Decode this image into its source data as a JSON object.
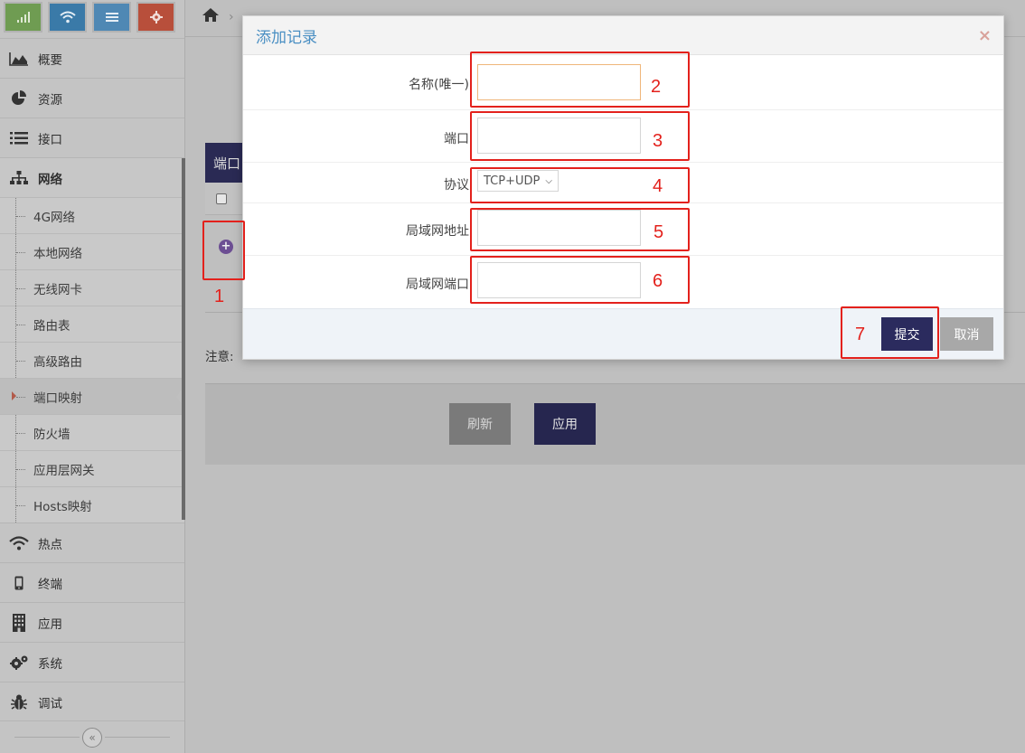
{
  "sidebar": {
    "shortcuts": [
      {
        "icon": "signal-icon",
        "color": "#6f9c52"
      },
      {
        "icon": "wifi-icon",
        "color": "#3a7aa8"
      },
      {
        "icon": "list-icon",
        "color": "#4f88b4"
      },
      {
        "icon": "gear-icon",
        "color": "#b84f3b"
      }
    ],
    "items_top": [
      {
        "label": "概要",
        "icon": "chart-area-icon"
      },
      {
        "label": "资源",
        "icon": "pie-chart-icon"
      },
      {
        "label": "接口",
        "icon": "list-icon"
      },
      {
        "label": "网络",
        "icon": "sitemap-icon"
      }
    ],
    "network_sub": [
      {
        "label": "4G网络"
      },
      {
        "label": "本地网络"
      },
      {
        "label": "无线网卡"
      },
      {
        "label": "路由表"
      },
      {
        "label": "高级路由"
      },
      {
        "label": "端口映射"
      },
      {
        "label": "防火墙"
      },
      {
        "label": "应用层网关"
      },
      {
        "label": "Hosts映射"
      }
    ],
    "items_bottom": [
      {
        "label": "热点",
        "icon": "wifi-icon"
      },
      {
        "label": "终端",
        "icon": "mobile-icon"
      },
      {
        "label": "应用",
        "icon": "building-icon"
      },
      {
        "label": "系统",
        "icon": "gears-icon"
      },
      {
        "label": "调试",
        "icon": "bug-icon"
      }
    ],
    "collapse_glyph": "«"
  },
  "main": {
    "breadcrumb_home_icon": "home-icon",
    "breadcrumb_sep": "›",
    "table_header_partial": "端口",
    "note_label": "注意:",
    "refresh_button": "刷新",
    "apply_button": "应用"
  },
  "modal": {
    "title": "添加记录",
    "close_glyph": "×",
    "fields": {
      "name_label": "名称(唯一)",
      "name_value": "",
      "port_label": "端口",
      "port_value": "",
      "protocol_label": "协议",
      "protocol_value": "TCP+UDP",
      "lan_addr_label": "局域网地址",
      "lan_addr_value": "",
      "lan_port_label": "局域网端口",
      "lan_port_value": ""
    },
    "submit_button": "提交",
    "cancel_button": "取消"
  },
  "annotations": [
    "1",
    "2",
    "3",
    "4",
    "5",
    "6",
    "7"
  ],
  "colors": {
    "accent_navy": "#2b2b5e",
    "annotation_red": "#e3211c",
    "modal_title_blue": "#4a8fc3"
  }
}
